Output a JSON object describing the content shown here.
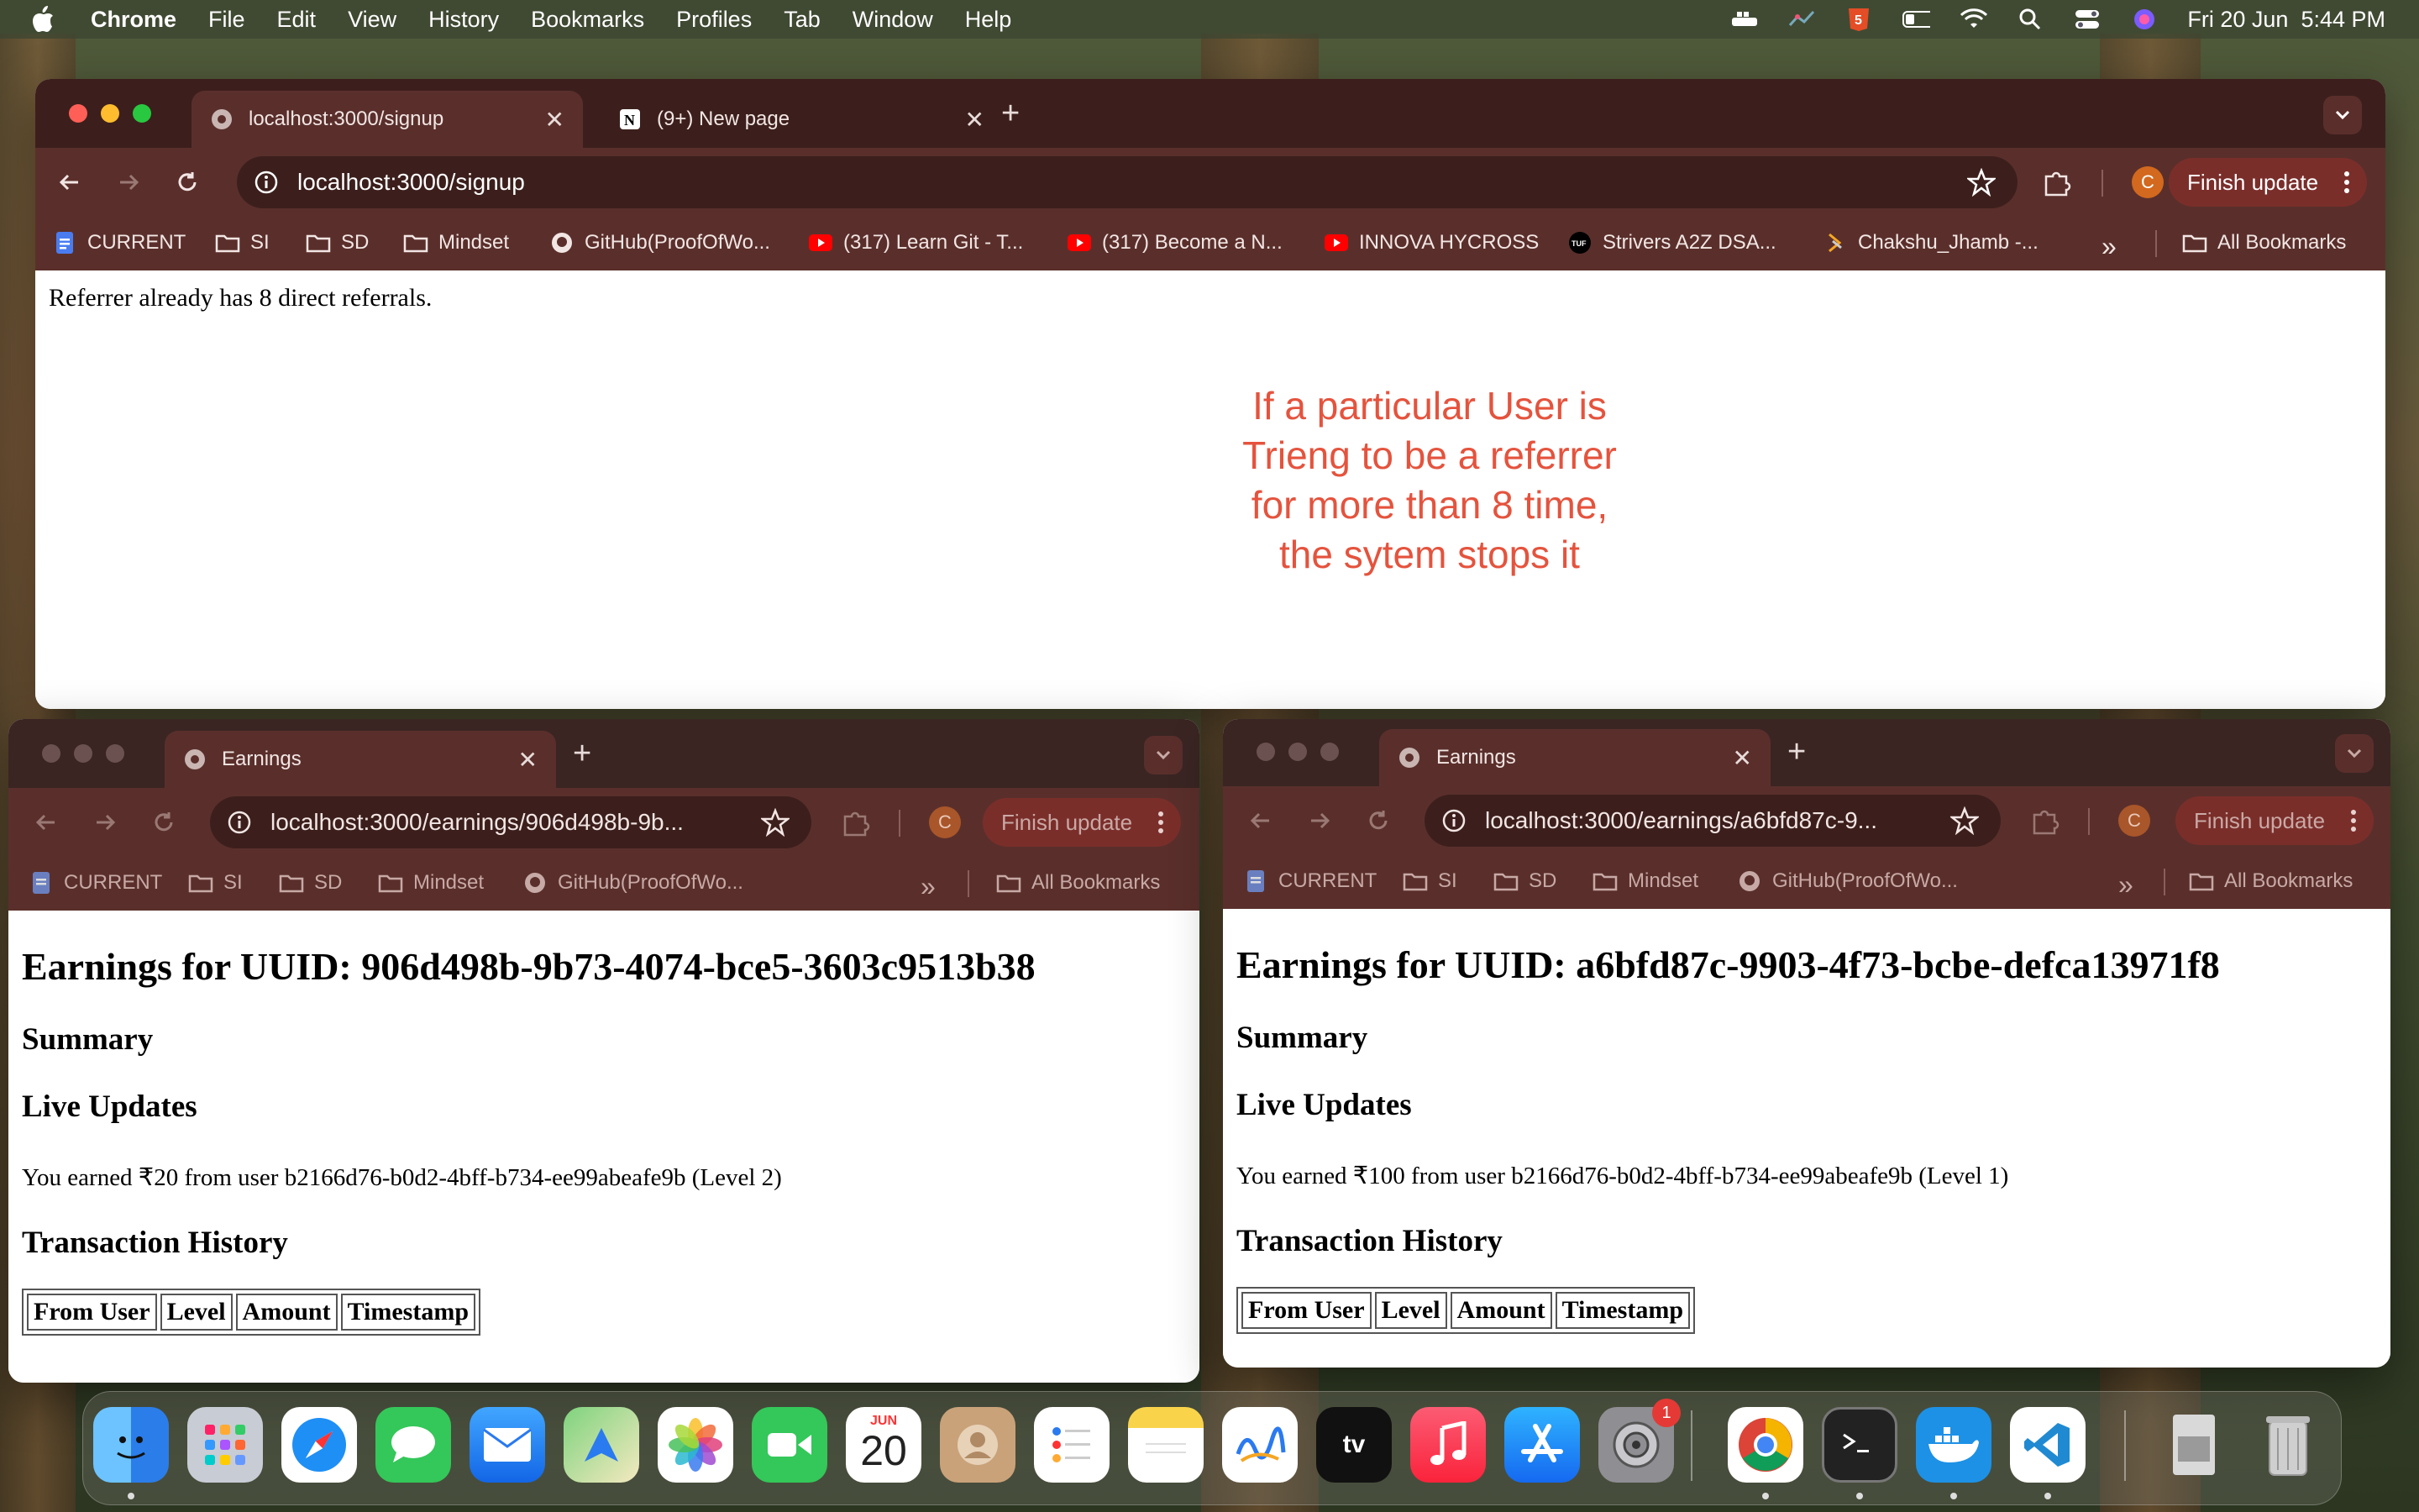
{
  "menubar": {
    "app": "Chrome",
    "items": [
      "File",
      "Edit",
      "View",
      "History",
      "Bookmarks",
      "Profiles",
      "Tab",
      "Window",
      "Help"
    ],
    "datetime": "Fri 20 Jun  5:44 PM"
  },
  "top_window": {
    "tabs": [
      {
        "title": "localhost:3000/signup",
        "icon": "globe-icon"
      },
      {
        "title": "(9+) New page",
        "icon": "notion-icon"
      }
    ],
    "url": "localhost:3000/signup",
    "finish_update": "Finish update",
    "avatar_letter": "C",
    "bookmarks": [
      "CURRENT",
      "SI",
      "SD",
      "Mindset",
      "GitHub(ProofOfWo...",
      "(317) Learn Git - T...",
      "(317) Become a N...",
      "INNOVA HYCROSS",
      "Strivers A2Z DSA...",
      "Chakshu_Jhamb -..."
    ],
    "more": "»",
    "all_bookmarks": "All Bookmarks",
    "page_text": "Referrer already has 8 direct referrals.",
    "note_lines": [
      "If a particular User is",
      "Trieng to be a referrer",
      "for more than 8 time,",
      "the sytem stops it"
    ]
  },
  "left_window": {
    "tab_title": "Earnings",
    "url": "localhost:3000/earnings/906d498b-9b...",
    "finish_update": "Finish update",
    "avatar_letter": "C",
    "bookmarks": [
      "CURRENT",
      "SI",
      "SD",
      "Mindset",
      "GitHub(ProofOfWo..."
    ],
    "more": "»",
    "all_bookmarks": "All Bookmarks",
    "heading": "Earnings for UUID: 906d498b-9b73-4074-bce5-3603c9513b38",
    "summary": "Summary",
    "live_updates": "Live Updates",
    "update_line": "You earned ₹20 from user b2166d76-b0d2-4bff-b734-ee99abeafe9b (Level 2)",
    "history": "Transaction History",
    "columns": [
      "From User",
      "Level",
      "Amount",
      "Timestamp"
    ]
  },
  "right_window": {
    "tab_title": "Earnings",
    "url": "localhost:3000/earnings/a6bfd87c-9...",
    "finish_update": "Finish update",
    "avatar_letter": "C",
    "bookmarks": [
      "CURRENT",
      "SI",
      "SD",
      "Mindset",
      "GitHub(ProofOfWo..."
    ],
    "more": "»",
    "all_bookmarks": "All Bookmarks",
    "heading": "Earnings for UUID: a6bfd87c-9903-4f73-bcbe-defca13971f8",
    "summary": "Summary",
    "live_updates": "Live Updates",
    "update_line": "You earned ₹100 from user b2166d76-b0d2-4bff-b734-ee99abeafe9b (Level 1)",
    "history": "Transaction History",
    "columns": [
      "From User",
      "Level",
      "Amount",
      "Timestamp"
    ]
  },
  "dock": {
    "apps": [
      "finder",
      "launchpad",
      "safari",
      "messages",
      "mail",
      "maps",
      "photos",
      "facetime",
      "calendar",
      "contacts",
      "reminders",
      "notes",
      "freeform",
      "apple-tv",
      "music",
      "app-store",
      "system-settings",
      "chrome",
      "terminal",
      "docker",
      "vscode",
      "downloads",
      "trash"
    ],
    "calendar_month": "JUN",
    "calendar_day": "20",
    "settings_badge": "1"
  }
}
